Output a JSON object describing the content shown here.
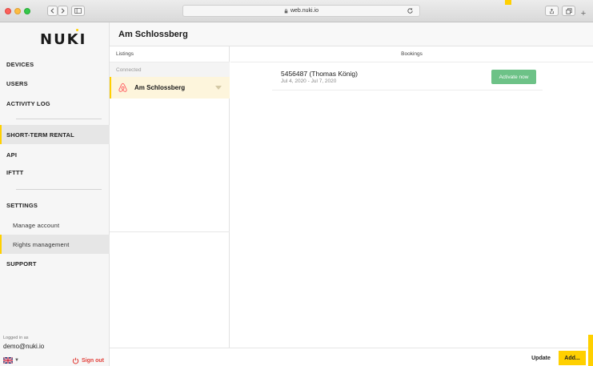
{
  "browser": {
    "url": "web.nuki.io"
  },
  "sidebar": {
    "logo": "NUKI",
    "items": [
      {
        "label": "DEVICES"
      },
      {
        "label": "USERS"
      },
      {
        "label": "ACTIVITY LOG"
      },
      {
        "label": "SHORT-TERM RENTAL",
        "active": true
      },
      {
        "label": "API"
      },
      {
        "label": "IFTTT"
      },
      {
        "label": "SETTINGS"
      },
      {
        "label": "Manage account"
      },
      {
        "label": "Rights management"
      },
      {
        "label": "SUPPORT"
      }
    ],
    "logged_in_label": "Logged in as",
    "user_email": "demo@nuki.io",
    "sign_out_label": "Sign out"
  },
  "header": {
    "title": "Am Schlossberg"
  },
  "listings": {
    "header": "Listings",
    "section": "Connected",
    "items": [
      {
        "name": "Am Schlossberg",
        "icon": "airbnb-icon"
      }
    ]
  },
  "bookings": {
    "header": "Bookings",
    "items": [
      {
        "title": "5456487 (Thomas König)",
        "dates": "Jul 4, 2020 - Jul 7, 2020",
        "action": "Activate now"
      }
    ]
  },
  "footer": {
    "update_label": "Update",
    "add_label": "Add..."
  },
  "colors": {
    "accent": "#ffd000",
    "activate": "#6dc287",
    "sign_out": "#e2413b"
  }
}
